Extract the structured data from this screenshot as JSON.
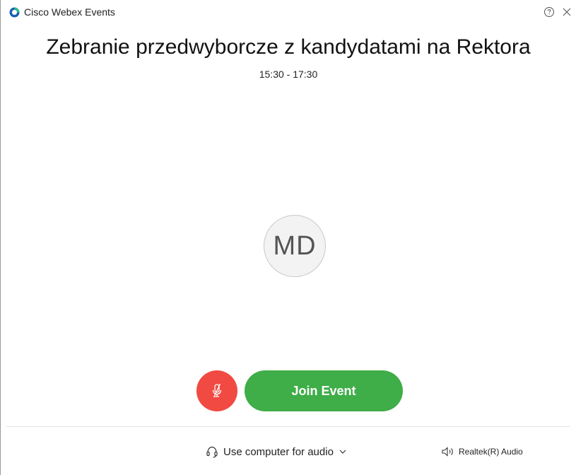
{
  "window": {
    "title": "Cisco Webex Events",
    "icons": {
      "logo": "webex-logo-icon",
      "help": "help-circle-icon",
      "close": "close-icon"
    }
  },
  "meeting": {
    "title": "Zebranie przedwyborcze z kandydatami na Rektora",
    "time": "15:30 - 17:30"
  },
  "avatar": {
    "initials": "MD"
  },
  "actions": {
    "mute_icon": "microphone-muted-icon",
    "join_label": "Join Event"
  },
  "footer": {
    "audio_option": "Use computer for audio",
    "audio_icon": "headset-icon",
    "speaker_label": "Realtek(R) Audio",
    "speaker_icon": "speaker-icon"
  },
  "colors": {
    "join_green": "#3fad48",
    "mute_red": "#f04a42",
    "logo_blue": "#1a5fb4"
  }
}
